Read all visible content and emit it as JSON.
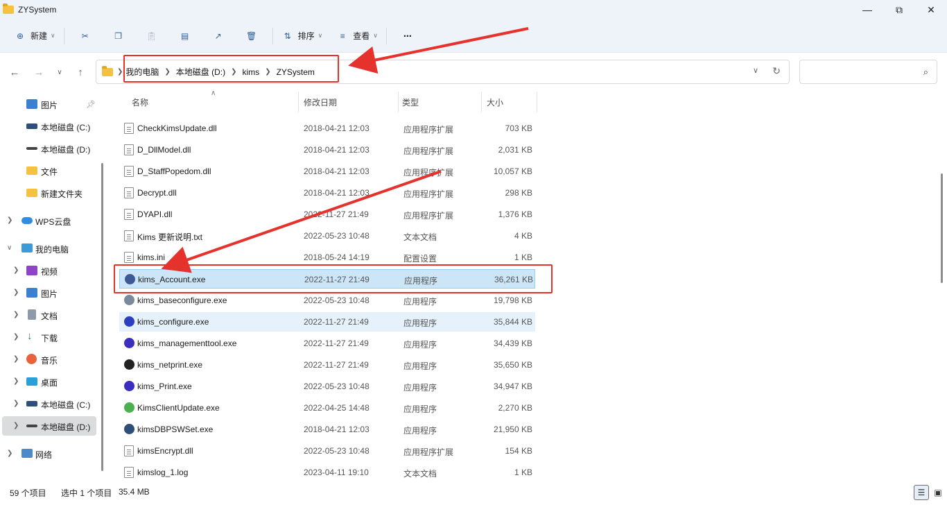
{
  "window": {
    "title": "ZYSystem",
    "minimize_icon": "minimize-icon",
    "maximize_icon": "maximize-icon",
    "close_icon": "close-icon"
  },
  "toolbar": {
    "new_label": "新建",
    "sort_label": "排序",
    "view_label": "查看",
    "icons": [
      "new-icon",
      "cut-icon",
      "copy-icon",
      "paste-icon",
      "rename-icon",
      "share-icon",
      "delete-icon",
      "sort-icon",
      "view-icon",
      "more-icon"
    ]
  },
  "address": {
    "crumbs": [
      "我的电脑",
      "本地磁盘 (D:)",
      "kims",
      "ZYSystem"
    ]
  },
  "search": {
    "placeholder": ""
  },
  "sidebar": {
    "items": [
      {
        "label": "图片",
        "icon": "pictures-icon",
        "pinned": true
      },
      {
        "label": "本地磁盘 (C:)",
        "icon": "drive-icon"
      },
      {
        "label": "本地磁盘 (D:)",
        "icon": "drive-icon"
      },
      {
        "label": "文件",
        "icon": "folder-icon"
      },
      {
        "label": "新建文件夹",
        "icon": "folder-icon"
      },
      {
        "label": "WPS云盘",
        "icon": "cloud-icon"
      },
      {
        "label": "我的电脑",
        "icon": "computer-icon"
      },
      {
        "label": "视频",
        "icon": "videos-icon"
      },
      {
        "label": "图片",
        "icon": "pictures-icon"
      },
      {
        "label": "文档",
        "icon": "documents-icon"
      },
      {
        "label": "下载",
        "icon": "downloads-icon"
      },
      {
        "label": "音乐",
        "icon": "music-icon"
      },
      {
        "label": "桌面",
        "icon": "desktop-icon"
      },
      {
        "label": "本地磁盘 (C:)",
        "icon": "drive-icon"
      },
      {
        "label": "本地磁盘 (D:)",
        "icon": "drive-icon"
      },
      {
        "label": "网络",
        "icon": "network-icon"
      }
    ]
  },
  "columns": {
    "name": "名称",
    "date": "修改日期",
    "type": "类型",
    "size": "大小"
  },
  "files": [
    {
      "name": "CheckKimsUpdate.dll",
      "date": "2018-04-21 12:03",
      "type": "应用程序扩展",
      "size": "703 KB",
      "icon": "dll-file-icon"
    },
    {
      "name": "D_DllModel.dll",
      "date": "2018-04-21 12:03",
      "type": "应用程序扩展",
      "size": "2,031 KB",
      "icon": "dll-file-icon"
    },
    {
      "name": "D_StaffPopedom.dll",
      "date": "2018-04-21 12:03",
      "type": "应用程序扩展",
      "size": "10,057 KB",
      "icon": "dll-file-icon"
    },
    {
      "name": "Decrypt.dll",
      "date": "2018-04-21 12:03",
      "type": "应用程序扩展",
      "size": "298 KB",
      "icon": "dll-file-icon"
    },
    {
      "name": "DYAPI.dll",
      "date": "2022-11-27 21:49",
      "type": "应用程序扩展",
      "size": "1,376 KB",
      "icon": "dll-file-icon"
    },
    {
      "name": "Kims 更新说明.txt",
      "date": "2022-05-23 10:48",
      "type": "文本文档",
      "size": "4 KB",
      "icon": "text-file-icon"
    },
    {
      "name": "kims.ini",
      "date": "2018-05-24 14:19",
      "type": "配置设置",
      "size": "1 KB",
      "icon": "ini-file-icon"
    },
    {
      "name": "kims_Account.exe",
      "date": "2022-11-27 21:49",
      "type": "应用程序",
      "size": "36,261 KB",
      "icon": "account-app-icon"
    },
    {
      "name": "kims_baseconfigure.exe",
      "date": "2022-05-23 10:48",
      "type": "应用程序",
      "size": "19,798 KB",
      "icon": "tools-app-icon"
    },
    {
      "name": "kims_configure.exe",
      "date": "2022-11-27 21:49",
      "type": "应用程序",
      "size": "35,844 KB",
      "icon": "configure-app-icon"
    },
    {
      "name": "kims_managementtool.exe",
      "date": "2022-11-27 21:49",
      "type": "应用程序",
      "size": "34,439 KB",
      "icon": "p-app-icon"
    },
    {
      "name": "kims_netprint.exe",
      "date": "2022-11-27 21:49",
      "type": "应用程序",
      "size": "35,650 KB",
      "icon": "printer-app-icon"
    },
    {
      "name": "kims_Print.exe",
      "date": "2022-05-23 10:48",
      "type": "应用程序",
      "size": "34,947 KB",
      "icon": "p-app-icon"
    },
    {
      "name": "KimsClientUpdate.exe",
      "date": "2022-04-25 14:48",
      "type": "应用程序",
      "size": "2,270 KB",
      "icon": "update-app-icon"
    },
    {
      "name": "kimsDBPSWSet.exe",
      "date": "2018-04-21 12:03",
      "type": "应用程序",
      "size": "21,950 KB",
      "icon": "db-app-icon"
    },
    {
      "name": "kimsEncrypt.dll",
      "date": "2022-05-23 10:48",
      "type": "应用程序扩展",
      "size": "154 KB",
      "icon": "dll-file-icon"
    },
    {
      "name": "kimslog_1.log",
      "date": "2023-04-11 19:10",
      "type": "文本文档",
      "size": "1 KB",
      "icon": "text-file-icon"
    }
  ],
  "status": {
    "count": "59 个项目",
    "selected": "选中 1 个项目",
    "selected_size": "35.4 MB"
  },
  "colors": {
    "annotation_red": "#e5322d",
    "selection_blue": "#cce5f7",
    "accent": "#2f5e98"
  }
}
